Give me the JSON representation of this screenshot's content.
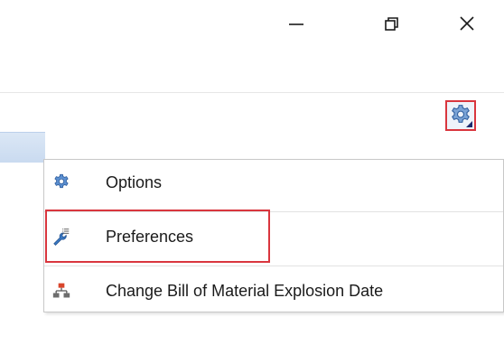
{
  "window_controls": {
    "minimize_icon": "minimize-icon",
    "restore_icon": "restore-icon",
    "close_icon": "close-icon"
  },
  "toolbar": {
    "settings_icon": "gear-icon"
  },
  "menu": {
    "items": [
      {
        "label": "Options",
        "icon": "gear-icon"
      },
      {
        "label": "Preferences",
        "icon": "wrench-list-icon"
      },
      {
        "label": "Change Bill of Material Explosion Date",
        "icon": "hierarchy-icon"
      }
    ]
  },
  "colors": {
    "highlight": "#d9363e",
    "gear_blue": "#3a78c2",
    "hierarchy_red": "#d9452b"
  }
}
